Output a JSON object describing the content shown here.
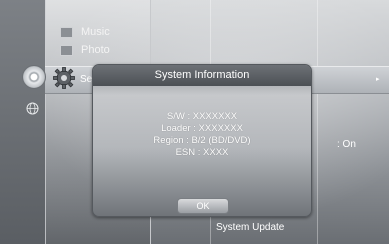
{
  "menu": {
    "items": [
      {
        "label": "Music",
        "icon": "music-icon"
      },
      {
        "label": "Photo",
        "icon": "photo-icon"
      },
      {
        "label": "Se",
        "icon": "gear-icon"
      }
    ]
  },
  "dialog": {
    "title": "System Information",
    "lines": [
      "S/W : XXXXXXX",
      "Loader : XXXXXXX",
      "Region : B/2 (BD/DVD)",
      "ESN : XXXX"
    ],
    "ok_label": "OK"
  },
  "settings": {
    "value_on": ": On",
    "bottom_item": "System Update"
  }
}
